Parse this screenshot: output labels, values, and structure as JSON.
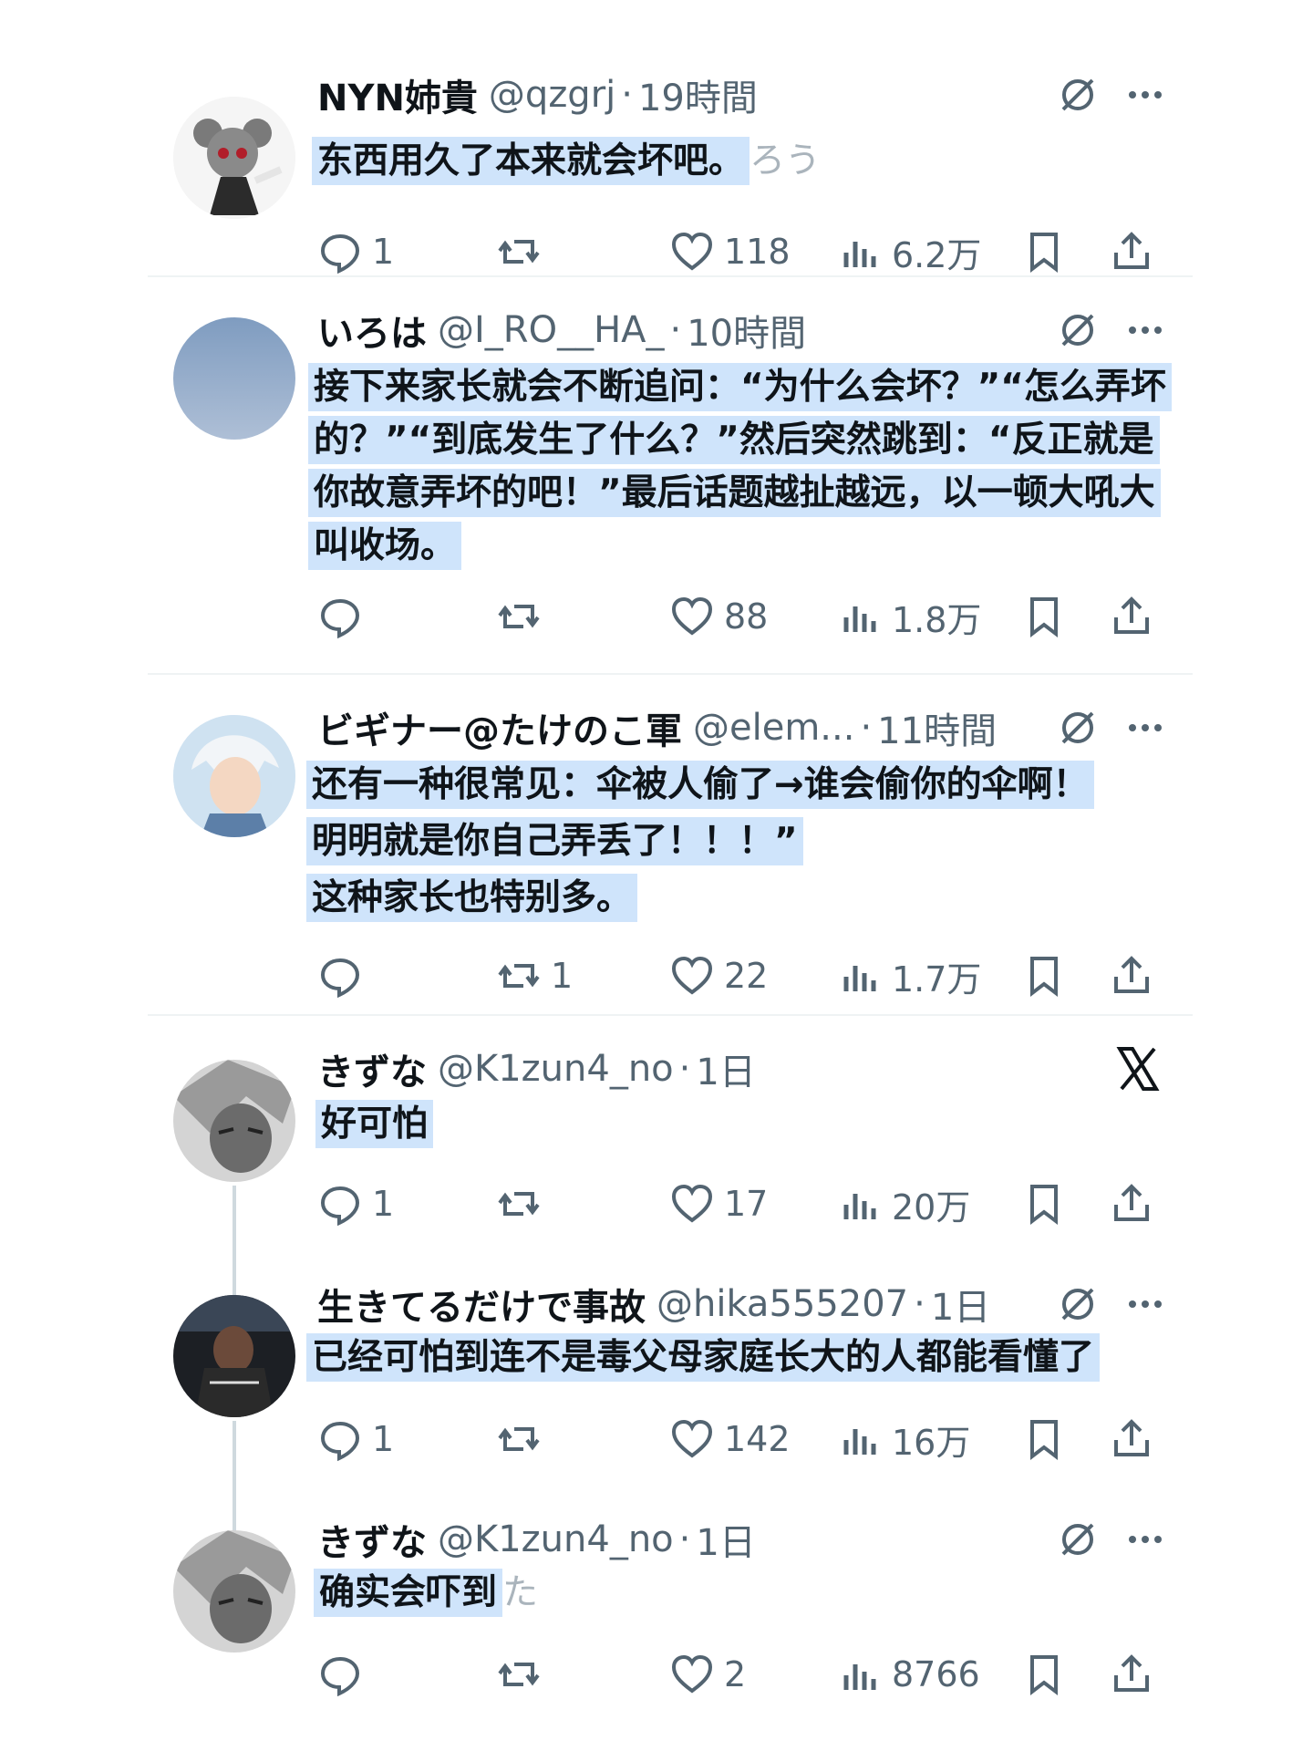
{
  "tweets": [
    {
      "name": "NYN姉貴",
      "handle": "@qzgrj",
      "sep": "·",
      "time": "19時間",
      "text_lines": [
        "东西用久了本来就会坏吧。"
      ],
      "trailing": "ろう",
      "replies": "1",
      "retweets": "",
      "likes": "118",
      "views": "6.2万",
      "header_right": "grok",
      "avatar_colors": [
        "#f2f2f2",
        "#555555",
        "#b11e2a",
        "#2b2b2b"
      ]
    },
    {
      "name": "いろは",
      "handle": "@I_RO__HA_",
      "sep": "·",
      "time": "10時間",
      "text_lines": [
        "接下来家长就会不断追问：“为什么会坏？”“怎么弄坏",
        "的？”“到底发生了什么？”然后突然跳到：“反正就是",
        "你故意弄坏的吧！”最后话题越扯越远，以一顿大吼大",
        "叫收场。"
      ],
      "trailing": "",
      "replies": "",
      "retweets": "",
      "likes": "88",
      "views": "1.8万",
      "header_right": "grok",
      "avatar_colors": [
        "#7f9cc0",
        "#aebfd6"
      ]
    },
    {
      "name": "ビギナー@たけのこ軍",
      "handle": "@elem...",
      "sep": "·",
      "time": "11時間",
      "text_lines": [
        "还有一种很常见：伞被人偷了→谁会偷你的伞啊！",
        "明明就是你自己弄丢了！！！”",
        "这种家长也特别多。"
      ],
      "trailing": "",
      "replies": "",
      "retweets": "1",
      "likes": "22",
      "views": "1.7万",
      "header_right": "grok",
      "avatar_colors": [
        "#d6e8f5",
        "#e9eef4",
        "#5c7fa8"
      ]
    },
    {
      "name": "きずな",
      "handle": "@K1zun4_no",
      "sep": "·",
      "time": "1日",
      "text_lines": [
        "好可怕"
      ],
      "trailing": "",
      "replies": "1",
      "retweets": "",
      "likes": "17",
      "views": "20万",
      "header_right": "x-logo",
      "avatar_colors": [
        "#c9c9c9",
        "#4d4d4d"
      ]
    },
    {
      "name": "生きてるだけで事故",
      "handle": "@hika555207",
      "sep": "·",
      "time": "1日",
      "text_lines": [
        "已经可怕到连不是毒父母家庭长大的人都能看懂了"
      ],
      "trailing": "",
      "replies": "1",
      "retweets": "",
      "likes": "142",
      "views": "16万",
      "header_right": "grok",
      "avatar_colors": [
        "#1c1f24",
        "#6b4a3a"
      ]
    },
    {
      "name": "きずな",
      "handle": "@K1zun4_no",
      "sep": "·",
      "time": "1日",
      "text_lines": [
        "确实会吓到"
      ],
      "trailing": "た",
      "replies": "",
      "retweets": "",
      "likes": "2",
      "views": "8766",
      "header_right": "grok",
      "avatar_colors": [
        "#c9c9c9",
        "#4d4d4d"
      ]
    }
  ],
  "colors": {
    "text": "#0f1419",
    "secondary": "#536471",
    "highlight": "#cfe4fb",
    "divider": "#eff3f4",
    "thread_line": "#cfd9de"
  }
}
